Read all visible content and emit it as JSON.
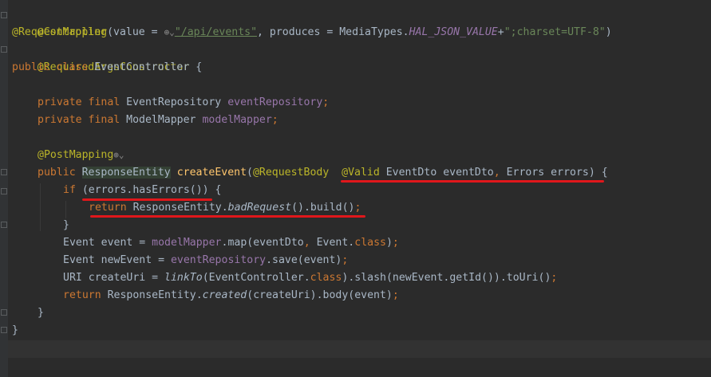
{
  "code": {
    "l1": {
      "ann": "@Controller"
    },
    "l2": {
      "ann": "@RequestMapping",
      "p1": "(value = ",
      "icon": "⊕⌄",
      "str": "\"/api/events\"",
      "p2": ", produces = MediaTypes.",
      "const": "HAL_JSON_VALUE",
      "p3": "+",
      "str2": "\";charset=UTF-8\"",
      "p4": ")"
    },
    "l3": {
      "ann": "@RequiredArgsConstructor"
    },
    "l4": {
      "kw": "public class ",
      "rest": "EventController {"
    },
    "l6": {
      "kw": "private final ",
      "type": "EventRepository ",
      "fld": "eventRepository",
      "end": ";"
    },
    "l7": {
      "kw": "private final ",
      "type": "ModelMapper ",
      "fld": "modelMapper",
      "end": ";"
    },
    "l9": {
      "ann": "@PostMapping",
      "icon": "⊕⌄"
    },
    "l10": {
      "kw": "public ",
      "type": "ResponseEntity",
      "sp": " ",
      "mth": "createEvent",
      "p1": "(",
      "ann1": "@RequestBody",
      "sp2": "  ",
      "ann2": "@Valid",
      "p2": " EventDto eventDto",
      "c": ", ",
      "p3": "Errors errors) {"
    },
    "l11": {
      "kw": "if ",
      "p1": "(errors.hasErrors()) {"
    },
    "l12": {
      "kw": "return ",
      "p1": "ResponseEntity.",
      "ital": "badRequest",
      "p2": "().build()",
      "end": ";"
    },
    "l13": {
      "p1": "}"
    },
    "l14": {
      "p1": "Event event = ",
      "fld": "modelMapper",
      "p2": ".map(eventDto",
      "c": ", ",
      "p3": "Event.",
      "kw": "class",
      "p4": ")",
      "end": ";"
    },
    "l15": {
      "p1": "Event newEvent = ",
      "fld": "eventRepository",
      "p2": ".save(event)",
      "end": ";"
    },
    "l16": {
      "p1": "URI createUri = ",
      "ital": "linkTo",
      "p2": "(EventController.",
      "kw": "class",
      "p3": ").slash(newEvent.getId()).toUri()",
      "end": ";"
    },
    "l17": {
      "kw": "return ",
      "p1": "ResponseEntity.",
      "ital": "created",
      "p2": "(createUri).body(event)",
      "end": ";"
    },
    "l18": {
      "p1": "}"
    },
    "l19": {
      "p1": "}"
    }
  },
  "colors": {
    "background": "#2b2b2b",
    "annotation": "#bbb529",
    "keyword": "#cc7832",
    "string": "#6a8759",
    "field": "#9876aa",
    "method": "#ffc66d",
    "text": "#a9b7c6",
    "red_underline": "#e0171b"
  }
}
